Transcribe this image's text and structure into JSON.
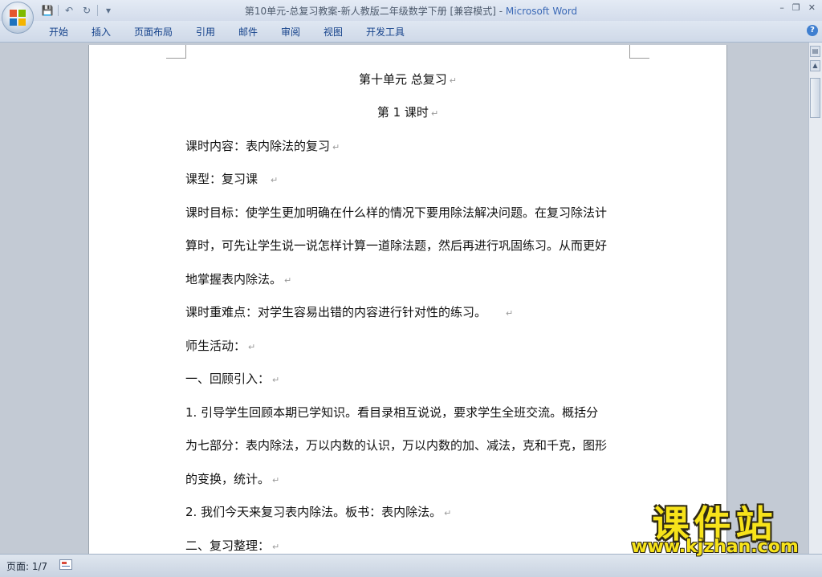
{
  "window": {
    "doc_title": "第10单元-总复习教案-新人教版二年级数学下册 [兼容模式]",
    "separator": " - ",
    "app_name": "Microsoft Word",
    "minimize": "–",
    "restore": "❐",
    "close": "✕"
  },
  "ribbon": {
    "tabs": [
      "开始",
      "插入",
      "页面布局",
      "引用",
      "邮件",
      "审阅",
      "视图",
      "开发工具"
    ],
    "help": "?"
  },
  "qat": {
    "save_icon": "💾",
    "undo_icon": "↶",
    "redo_icon": "↻",
    "more_icon": "▾"
  },
  "document": {
    "pilcrow": "↵",
    "lines": [
      "第十单元 总复习",
      "第 1 课时",
      "课时内容：表内除法的复习",
      "课型：复习课",
      "课时目标：使学生更加明确在什么样的情况下要用除法解决问题。在复习除法计",
      "算时，可先让学生说一说怎样计算一道除法题，然后再进行巩固练习。从而更好",
      "地掌握表内除法。",
      "课时重难点：对学生容易出错的内容进行针对性的练习。",
      "师生活动：",
      "一、回顾引入：",
      "1. 引导学生回顾本期已学知识。看目录相互说说，要求学生全班交流。概括分",
      "为七部分：表内除法，万以内数的认识，万以内数的加、减法，克和千克，图形",
      "的变换，统计。",
      "2. 我们今天来复习表内除法。板书：表内除法。",
      "二、复习整理："
    ]
  },
  "statusbar": {
    "page": "页面: 1/7"
  },
  "watermark": {
    "text": "课件站",
    "url": "www.kjzhan.com"
  },
  "colors": {
    "app_name": "#3b69b6",
    "tab_text": "#15428b",
    "watermark": "#f7e31a"
  }
}
